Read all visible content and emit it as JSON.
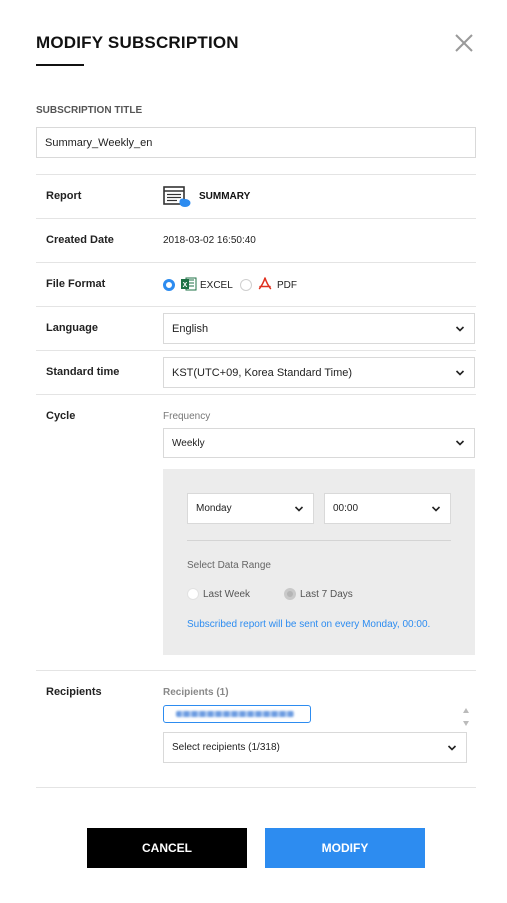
{
  "dialog": {
    "title": "MODIFY SUBSCRIPTION",
    "close_icon": "close-icon"
  },
  "subscription": {
    "title_label": "SUBSCRIPTION TITLE",
    "title_value": "Summary_Weekly_en"
  },
  "report": {
    "label": "Report",
    "icon": "report-table-icon",
    "name": "SUMMARY"
  },
  "created": {
    "label": "Created Date",
    "value": "2018-03-02 16:50:40"
  },
  "file_format": {
    "label": "File Format",
    "options": [
      {
        "label": "EXCEL",
        "selected": true,
        "icon": "excel-icon"
      },
      {
        "label": "PDF",
        "selected": false,
        "icon": "pdf-icon"
      }
    ]
  },
  "language": {
    "label": "Language",
    "value": "English"
  },
  "standard_time": {
    "label": "Standard time",
    "value": "KST(UTC+09, Korea Standard Time)"
  },
  "cycle": {
    "label": "Cycle",
    "frequency_label": "Frequency",
    "frequency_value": "Weekly",
    "day_value": "Monday",
    "time_value": "00:00",
    "range_label": "Select Data Range",
    "range_options": [
      {
        "label": "Last Week",
        "selected": false
      },
      {
        "label": "Last 7 Days",
        "selected": true
      }
    ],
    "notice": "Subscribed report will be sent on every Monday, 00:00."
  },
  "recipients": {
    "label": "Recipients",
    "count_label": "Recipients (1)",
    "select_placeholder": "Select recipients (1/318)"
  },
  "buttons": {
    "cancel": "CANCEL",
    "modify": "MODIFY"
  },
  "colors": {
    "accent": "#2d8cf0",
    "cancel_bg": "#000000",
    "excel": "#1e7145",
    "pdf": "#e0301e"
  }
}
